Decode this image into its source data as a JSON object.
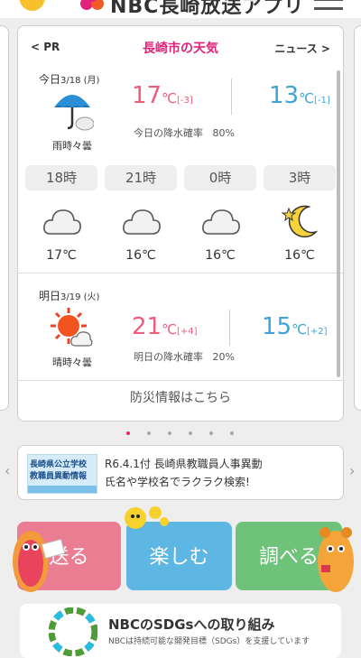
{
  "header": {
    "logo_text": "NBC長崎放送アプリ"
  },
  "weather": {
    "nav_left": "< PR",
    "title": "長崎市の天気",
    "nav_right": "ニュース >",
    "today": {
      "label": "今日",
      "date": "3/18 (月)",
      "condition": "雨時々曇",
      "high": "17",
      "high_diff": "[-3]",
      "low": "13",
      "low_diff": "[-1]",
      "unit": "℃",
      "rain_label": "今日の降水確率",
      "rain_value": "80%"
    },
    "hourly": [
      {
        "time": "18時",
        "temp": "17℃",
        "icon": "cloud-icon"
      },
      {
        "time": "21時",
        "temp": "16℃",
        "icon": "cloud-icon"
      },
      {
        "time": "0時",
        "temp": "16℃",
        "icon": "cloud-icon"
      },
      {
        "time": "3時",
        "temp": "16℃",
        "icon": "moon-icon"
      }
    ],
    "tomorrow": {
      "label": "明日",
      "date": "3/19 (火)",
      "condition": "晴時々曇",
      "high": "21",
      "high_diff": "[+4]",
      "low": "15",
      "low_diff": "[+2]",
      "unit": "℃",
      "rain_label": "明日の降水確率",
      "rain_value": "20%"
    },
    "disaster_link": "防災情報はこちら"
  },
  "banner": {
    "image_line1": "長崎県公立学校",
    "image_line2": "教職員異動情報",
    "line1": "R6.4.1付 長崎県教職員人事異動",
    "line2": "氏名や学校名でラクラク検索!"
  },
  "actions": {
    "send": "送る",
    "enjoy": "楽しむ",
    "search": "調べる"
  },
  "sdgs": {
    "title": "NBCのSDGsへの取り組み",
    "subtitle": "NBCは持続可能な開発目標（SDGs）を支援しています"
  },
  "colors": {
    "accent": "#e2237b",
    "temp_high": "#ef5d7b",
    "temp_low": "#3ea4d6",
    "send": "#eb7d92",
    "enjoy": "#5eb7e3",
    "search": "#6fc27a"
  }
}
